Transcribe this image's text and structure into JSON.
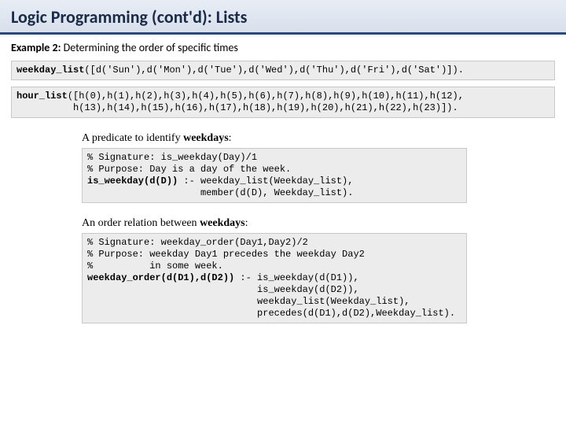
{
  "header": {
    "title": "Logic Programming (cont'd):   Lists"
  },
  "example": {
    "label": "Example 2:",
    "text": "  Determining the order of specific times"
  },
  "code1": {
    "kw": "weekday_list",
    "rest": "([d('Sun'),d('Mon'),d('Tue'),d('Wed'),d('Thu'),d('Fri'),d('Sat')])."
  },
  "code2": {
    "kw": "hour_list",
    "line1_rest": "([h(0),h(1),h(2),h(3),h(4),h(5),h(6),h(7),h(8),h(9),h(10),h(11),h(12),",
    "line2": "          h(13),h(14),h(15),h(16),h(17),h(18),h(19),h(20),h(21),h(22),h(23)])."
  },
  "section1": {
    "heading_pre": "A predicate to identify ",
    "heading_bold": "weekdays",
    "heading_post": ":",
    "c1": "% Signature: is_weekday(Day)/1",
    "c2": "% Purpose: Day is a day of the week.",
    "kw": "is_weekday(d(D))",
    "kw_rest": " :- weekday_list(Weekday_list),",
    "c4": "                    member(d(D), Weekday_list)."
  },
  "section2": {
    "heading_pre": "An order relation between ",
    "heading_bold": "weekdays",
    "heading_post": ":",
    "c1": "% Signature: weekday_order(Day1,Day2)/2",
    "c2": "% Purpose: weekday Day1 precedes the weekday Day2",
    "c3": "%          in some week.",
    "kw": "weekday_order(d(D1),d(D2))",
    "kw_rest": " :- is_weekday(d(D1)),",
    "c5": "                              is_weekday(d(D2)),",
    "c6": "                              weekday_list(Weekday_list),",
    "c7": "                              precedes(d(D1),d(D2),Weekday_list)."
  }
}
